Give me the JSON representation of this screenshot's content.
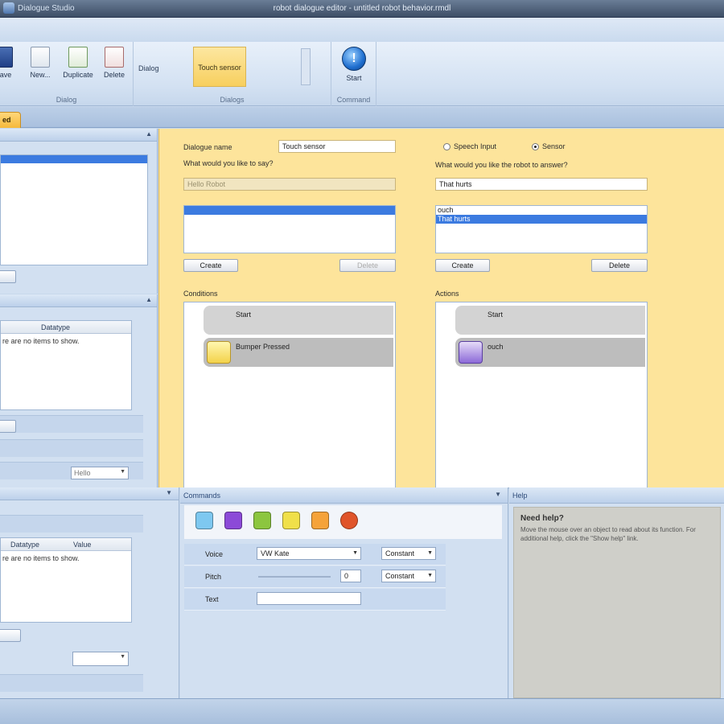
{
  "window": {
    "title": "robot dialogue editor - untitled robot behavior.rmdl",
    "app_name": "Dialogue Studio"
  },
  "ribbon": {
    "buttons": {
      "save": "Save",
      "new": "New...",
      "duplicate": "Duplicate",
      "delete": "Delete",
      "start": "Start"
    },
    "dialog_label": "Dialog",
    "touch_sensor": "Touch sensor",
    "groups": {
      "dialog": "Dialog",
      "dialogs": "Dialogs",
      "command": "Command"
    }
  },
  "doctab": {
    "label": "ed"
  },
  "left": {
    "grid1_header": "Datatype",
    "grid1_empty": "re are no items to show.",
    "grid1_combo": "Hello",
    "grid2_headers": {
      "datatype": "Datatype",
      "value": "Value"
    },
    "grid2_empty": "re are no items to show."
  },
  "editor": {
    "dialogue_name_label": "Dialogue name",
    "dialogue_name_value": "Touch sensor",
    "say_prompt": "What would you like to say?",
    "say_placeholder": "Hello Robot",
    "radio_speech": "Speech Input",
    "radio_sensor": "Sensor",
    "answer_prompt": "What would you like the robot to answer?",
    "answer_value": "That hurts",
    "answer_list": [
      "ouch",
      "That hurts"
    ],
    "create_left": "Create",
    "delete_left": "Delete",
    "create_right": "Create",
    "delete_right": "Delete",
    "conditions_label": "Conditions",
    "actions_label": "Actions",
    "cond_blocks": [
      "Start",
      "Bumper Pressed"
    ],
    "action_blocks": [
      "Start",
      "ouch"
    ]
  },
  "commands": {
    "title": "Commands",
    "colors": [
      "#7ec8f0",
      "#8c4ad8",
      "#8cc63f",
      "#f0e04a",
      "#f5a33a",
      "#e0542a"
    ],
    "rows": [
      {
        "label": "Voice",
        "value": "VW Kate",
        "mode": "Constant"
      },
      {
        "label": "Pitch",
        "value": "0",
        "mode": "Constant"
      },
      {
        "label": "Text",
        "value": ""
      }
    ]
  },
  "help": {
    "title": "Help",
    "heading": "Need help?",
    "text": "Move the mouse over an object to read about its function. For additional help, click the \"Show help\" link."
  }
}
